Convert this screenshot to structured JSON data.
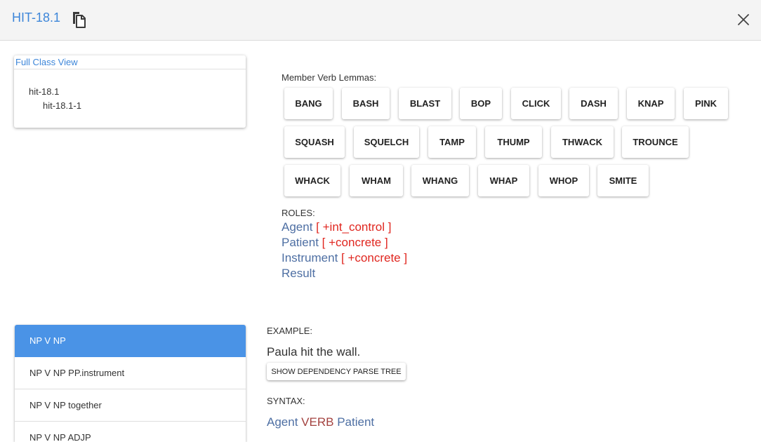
{
  "header": {
    "title": "HIT-18.1",
    "copy_icon": "copy-icon",
    "close_icon": "close-icon"
  },
  "class_view": {
    "heading": "Full Class View",
    "tree": {
      "root": "hit-18.1",
      "child": "hit-18.1-1"
    }
  },
  "member_lemmas": {
    "label": "Member Verb Lemmas:",
    "lemmas": [
      "BANG",
      "BASH",
      "BLAST",
      "BOP",
      "CLICK",
      "DASH",
      "KNAP",
      "PINK",
      "SQUASH",
      "SQUELCH",
      "TAMP",
      "THUMP",
      "THWACK",
      "TROUNCE",
      "WHACK",
      "WHAM",
      "WHANG",
      "WHAP",
      "WHOP",
      "SMITE"
    ]
  },
  "roles": {
    "label": "ROLES:",
    "items": [
      {
        "name": "Agent",
        "restriction": "[ +int_control ]"
      },
      {
        "name": "Patient",
        "restriction": "[ +concrete ]"
      },
      {
        "name": "Instrument",
        "restriction": "[ +concrete ]"
      },
      {
        "name": "Result",
        "restriction": ""
      }
    ]
  },
  "frames": {
    "selected_index": 0,
    "items": [
      "NP V NP",
      "NP V NP PP.instrument",
      "NP V NP together",
      "NP V NP ADJP"
    ]
  },
  "example": {
    "label": "EXAMPLE:",
    "sentence": "Paula hit the wall.",
    "dep_button": "SHOW DEPENDENCY PARSE TREE"
  },
  "syntax": {
    "label": "SYNTAX:",
    "tokens": [
      {
        "text": "Agent",
        "kind": "np"
      },
      {
        "text": "VERB",
        "kind": "verb"
      },
      {
        "text": "Patient",
        "kind": "np"
      }
    ]
  },
  "colors": {
    "accent": "#3d86d9",
    "selected": "#4a93e6",
    "role": "#4e6fa3",
    "restriction": "#e0261f",
    "verb": "#a3423f"
  }
}
